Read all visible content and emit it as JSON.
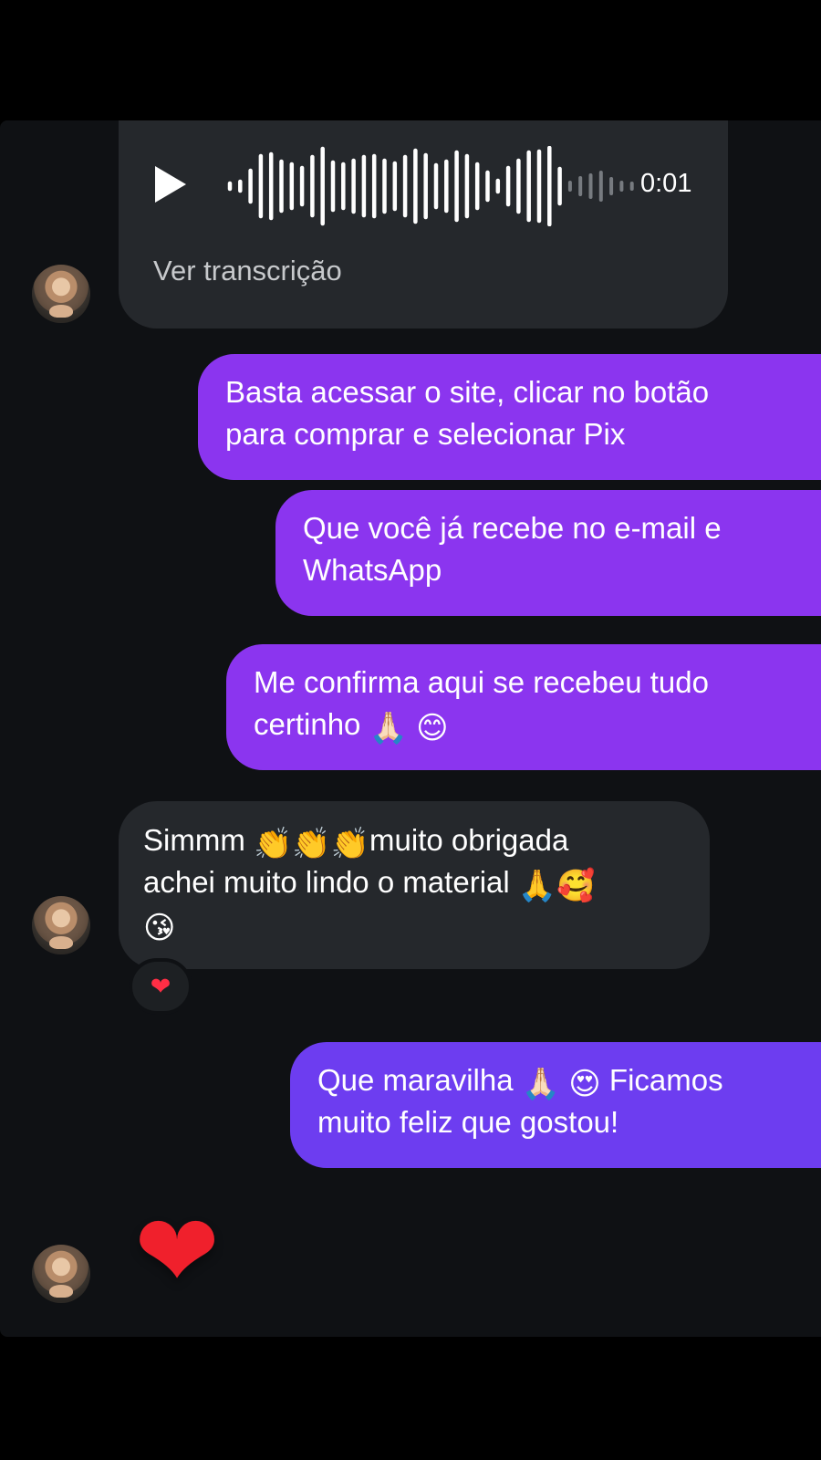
{
  "voice_message": {
    "duration": "0:01",
    "transcript_link": "Ver transcrição"
  },
  "messages": [
    {
      "text": "Basta acessar o site, clicar no botão",
      "text2": "para comprar e selecionar Pix"
    },
    {
      "text": "Que você já recebe no e-mail e",
      "text2": "WhatsApp"
    },
    {
      "text": "Me confirma aqui se recebeu tudo",
      "text2": "certinho"
    },
    {
      "line1_before": "Simmm",
      "line1_after": "muito obrigada",
      "line2": "achei muito lindo o material"
    },
    {
      "line1": "Que maravilha",
      "line1_after": "Ficamos",
      "line2": "muito feliz que gostou!"
    }
  ],
  "icons": {
    "play": "play-icon",
    "waveform": "audio-waveform-icon",
    "reaction": "red-heart-reaction-icon",
    "big_heart": "red-heart-emoji-icon"
  }
}
